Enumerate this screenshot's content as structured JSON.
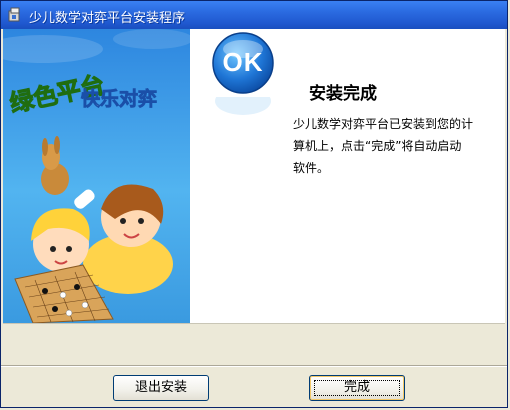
{
  "window": {
    "title": "少儿数学对弈平台安装程序"
  },
  "banner": {
    "line1": "绿色平台",
    "line2": "快乐对弈"
  },
  "main": {
    "ok_text": "OK",
    "heading": "安装完成",
    "description": "少儿数学对弈平台已安装到您的计算机上，点击“完成”将自动启动软件。"
  },
  "buttons": {
    "exit": "退出安装",
    "finish": "完成"
  },
  "colors": {
    "titlebar": "#2a6ae0",
    "banner_sky": "#3aa0e8",
    "ok_badge": "#1e6fd0"
  }
}
